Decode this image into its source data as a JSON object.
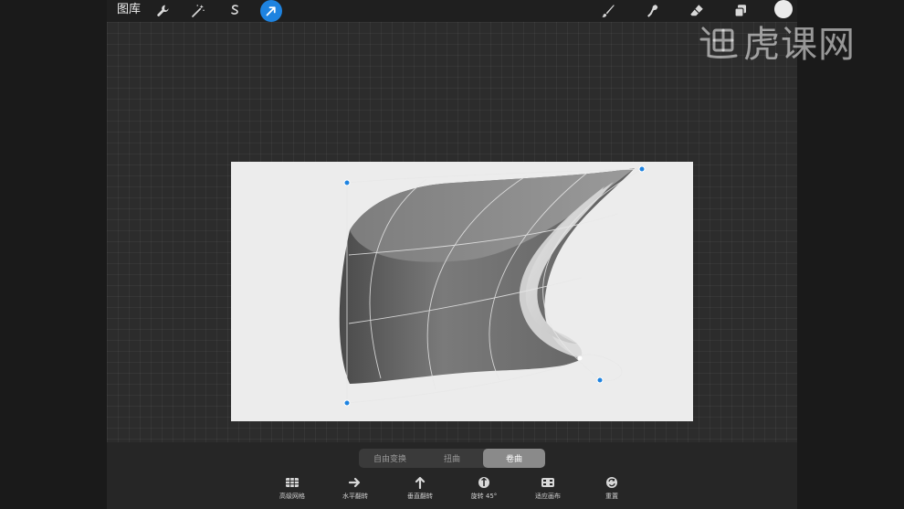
{
  "topbar": {
    "gallery_label": "图库",
    "tools_left": [
      "wrench-icon",
      "magic-wand-icon",
      "selection-s-icon",
      "transform-arrow-icon"
    ],
    "tools_right": [
      "brush-icon",
      "smudge-icon",
      "eraser-icon",
      "layers-icon"
    ],
    "active_tool": "transform-arrow-icon",
    "color_swatch": "#ebebeb",
    "accent": "#1e83e0"
  },
  "transform_modes": {
    "items": [
      "自由变换",
      "扭曲",
      "卷曲"
    ],
    "selected": "卷曲"
  },
  "bottom_tools": [
    {
      "label": "高级网格",
      "icon": "grid-icon"
    },
    {
      "label": "水平翻转",
      "icon": "arrow-right-icon"
    },
    {
      "label": "垂直翻转",
      "icon": "arrow-up-icon"
    },
    {
      "label": "旋转 45°",
      "icon": "rotate-icon"
    },
    {
      "label": "适应画布",
      "icon": "fit-canvas-icon"
    },
    {
      "label": "重置",
      "icon": "reset-icon"
    }
  ],
  "watermark": {
    "text": "虎课网"
  }
}
